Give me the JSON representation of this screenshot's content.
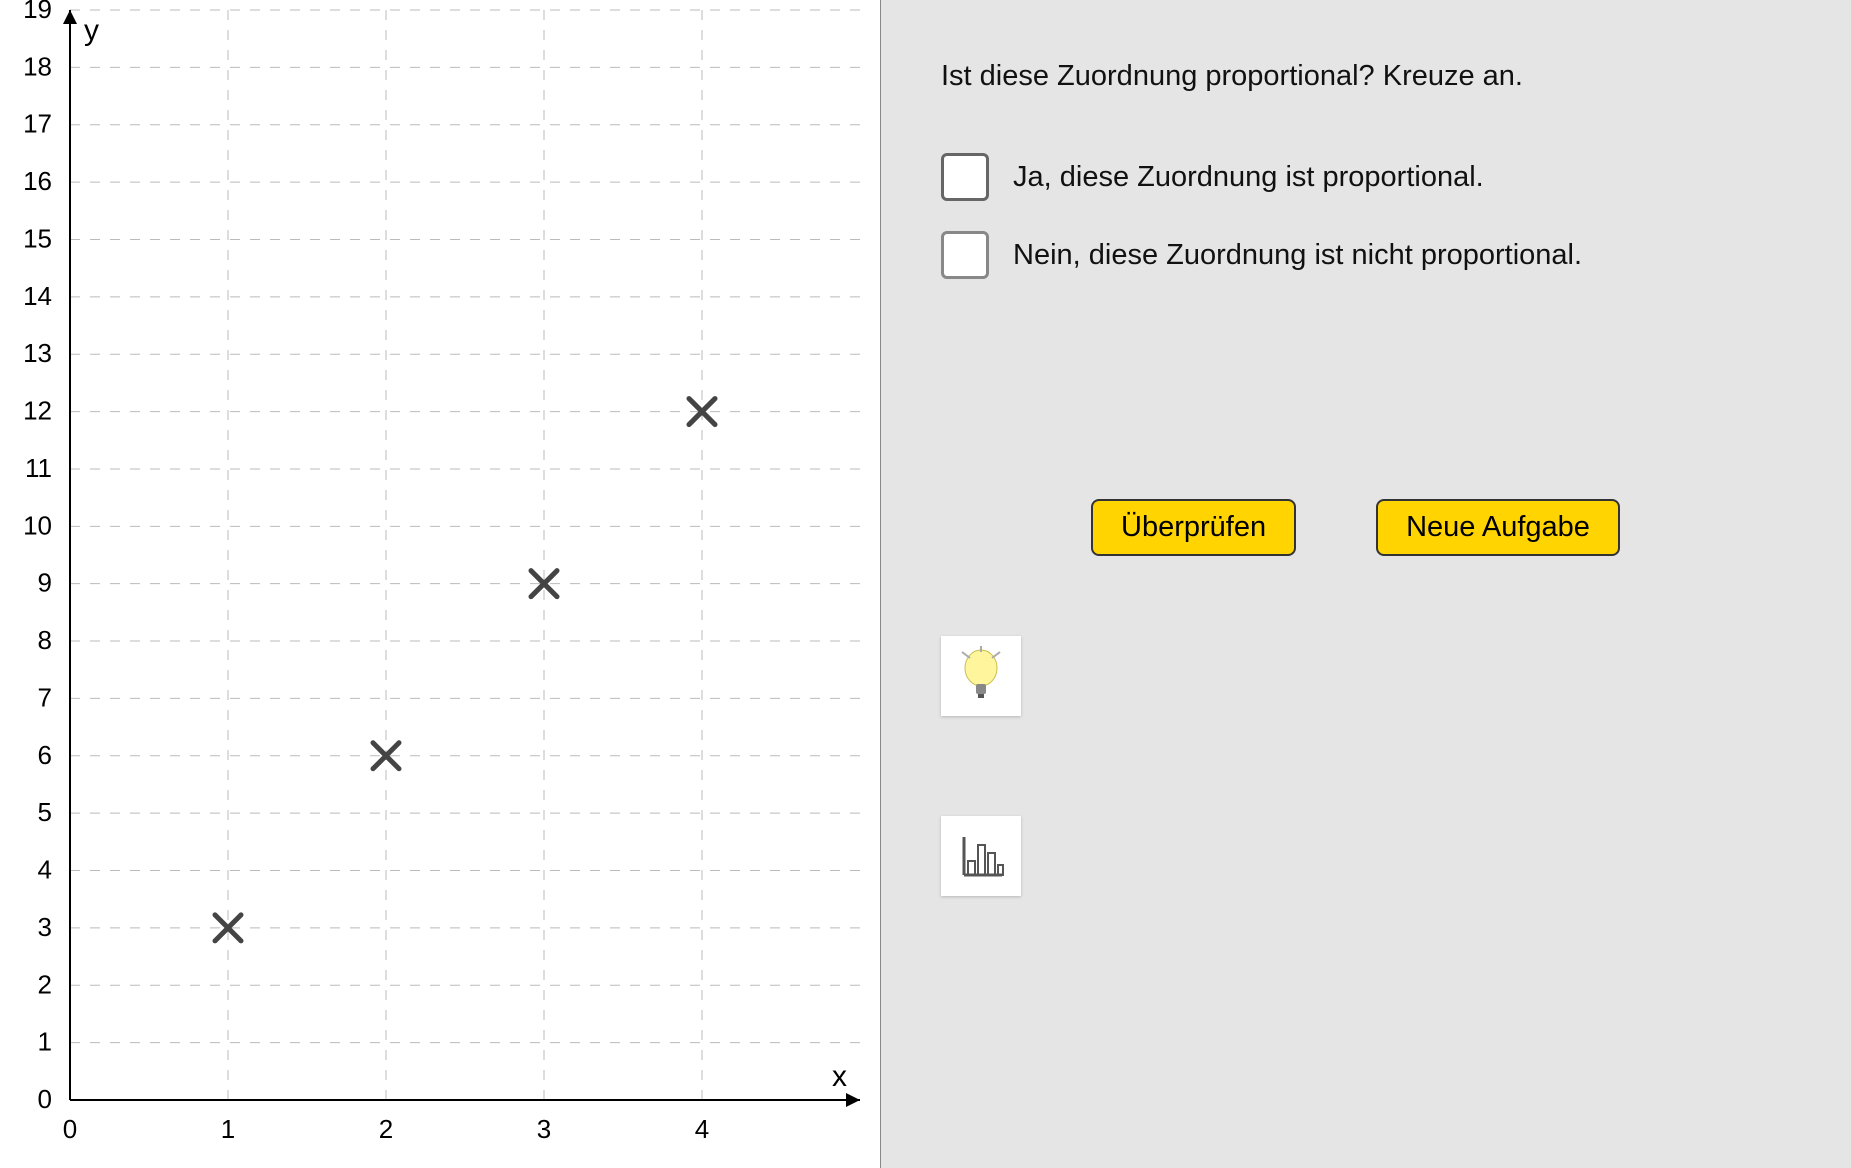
{
  "chart_data": {
    "type": "scatter",
    "title": "",
    "xlabel": "x",
    "ylabel": "y",
    "xlim": [
      0,
      5
    ],
    "ylim": [
      0,
      19
    ],
    "x_ticks": [
      0,
      1,
      2,
      3,
      4
    ],
    "y_ticks": [
      0,
      1,
      2,
      3,
      4,
      5,
      6,
      7,
      8,
      9,
      10,
      11,
      12,
      13,
      14,
      15,
      16,
      17,
      18,
      19
    ],
    "points": [
      {
        "x": 1,
        "y": 3
      },
      {
        "x": 2,
        "y": 6
      },
      {
        "x": 3,
        "y": 9
      },
      {
        "x": 4,
        "y": 12
      }
    ],
    "marker": "x",
    "grid": true
  },
  "question": "Ist diese Zuordnung proportional? Kreuze an.",
  "options": {
    "yes": "Ja, diese Zuordnung ist proportional.",
    "no": "Nein, diese Zuordnung ist nicht proportional."
  },
  "buttons": {
    "check": "Überprüfen",
    "new": "Neue Aufgabe"
  },
  "icons": {
    "hint": "lightbulb-icon",
    "stats": "bar-chart-icon"
  }
}
